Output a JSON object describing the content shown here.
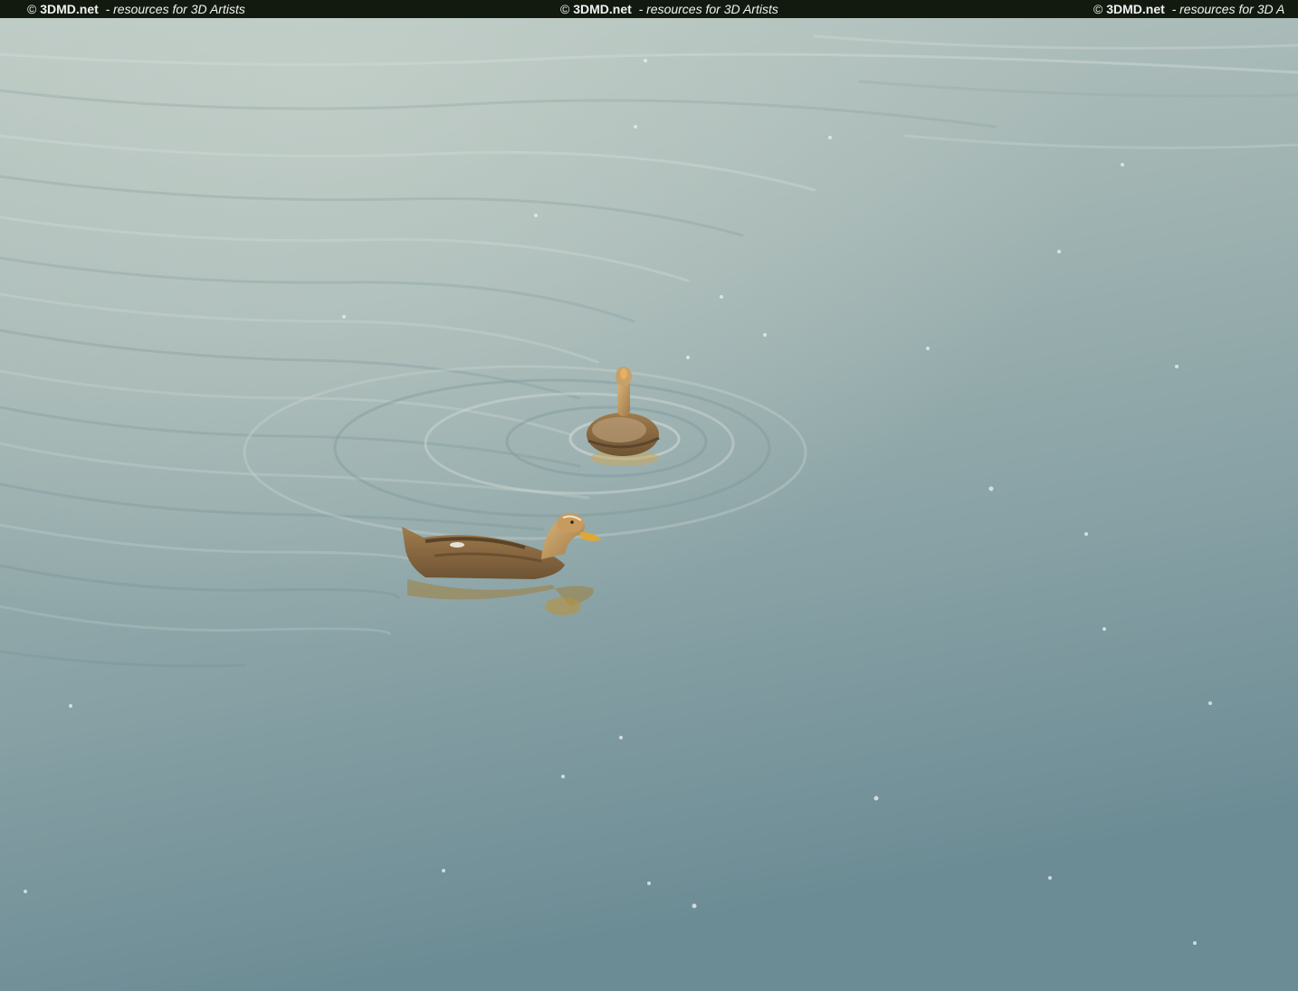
{
  "watermark": {
    "copyright": "©",
    "brand": "3DMD.net",
    "tagline": "- resources for 3D Artists",
    "tagline_cut": "- resources for 3D A"
  },
  "scene": {
    "subject": "two ducks swimming on calm water",
    "colors": {
      "water_light": "#b6c4c0",
      "water_mid": "#8ba3a6",
      "water_dark": "#6f8f97",
      "duck_brown": "#8a6a45",
      "duck_light": "#c9a671",
      "bill": "#e0a531"
    }
  }
}
